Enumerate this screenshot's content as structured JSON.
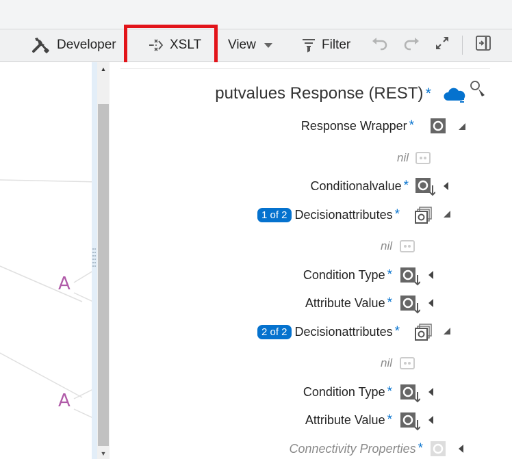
{
  "toolbar": {
    "developer": "Developer",
    "xslt": "XSLT",
    "view": "View",
    "filter": "Filter"
  },
  "tree": {
    "title": "putvalues Response (REST)",
    "rows": {
      "response_wrapper": "Response Wrapper",
      "nil": "nil",
      "conditionalvalue": "Conditionalvalue",
      "decisionattributes": "Decisionattributes",
      "condition_type": "Condition Type",
      "attribute_value": "Attribute Value",
      "connectivity_properties": "Connectivity Properties"
    },
    "required_mark": "*",
    "badges": [
      "1 of 2",
      "2 of 2"
    ]
  },
  "canvas": {
    "function_label": "A"
  },
  "icons": [
    "developer-tools-icon",
    "xslt-icon",
    "view-caret-icon",
    "filter-icon",
    "undo-icon",
    "redo-icon",
    "expand-icon",
    "panel-toggle-icon",
    "cloud-rest-icon",
    "search-icon",
    "element-node-icon",
    "nil-icon",
    "collection-node-icon"
  ],
  "colors": {
    "accent": "#0572ce",
    "highlight": "#e2141a",
    "function": "#b05aa8"
  }
}
